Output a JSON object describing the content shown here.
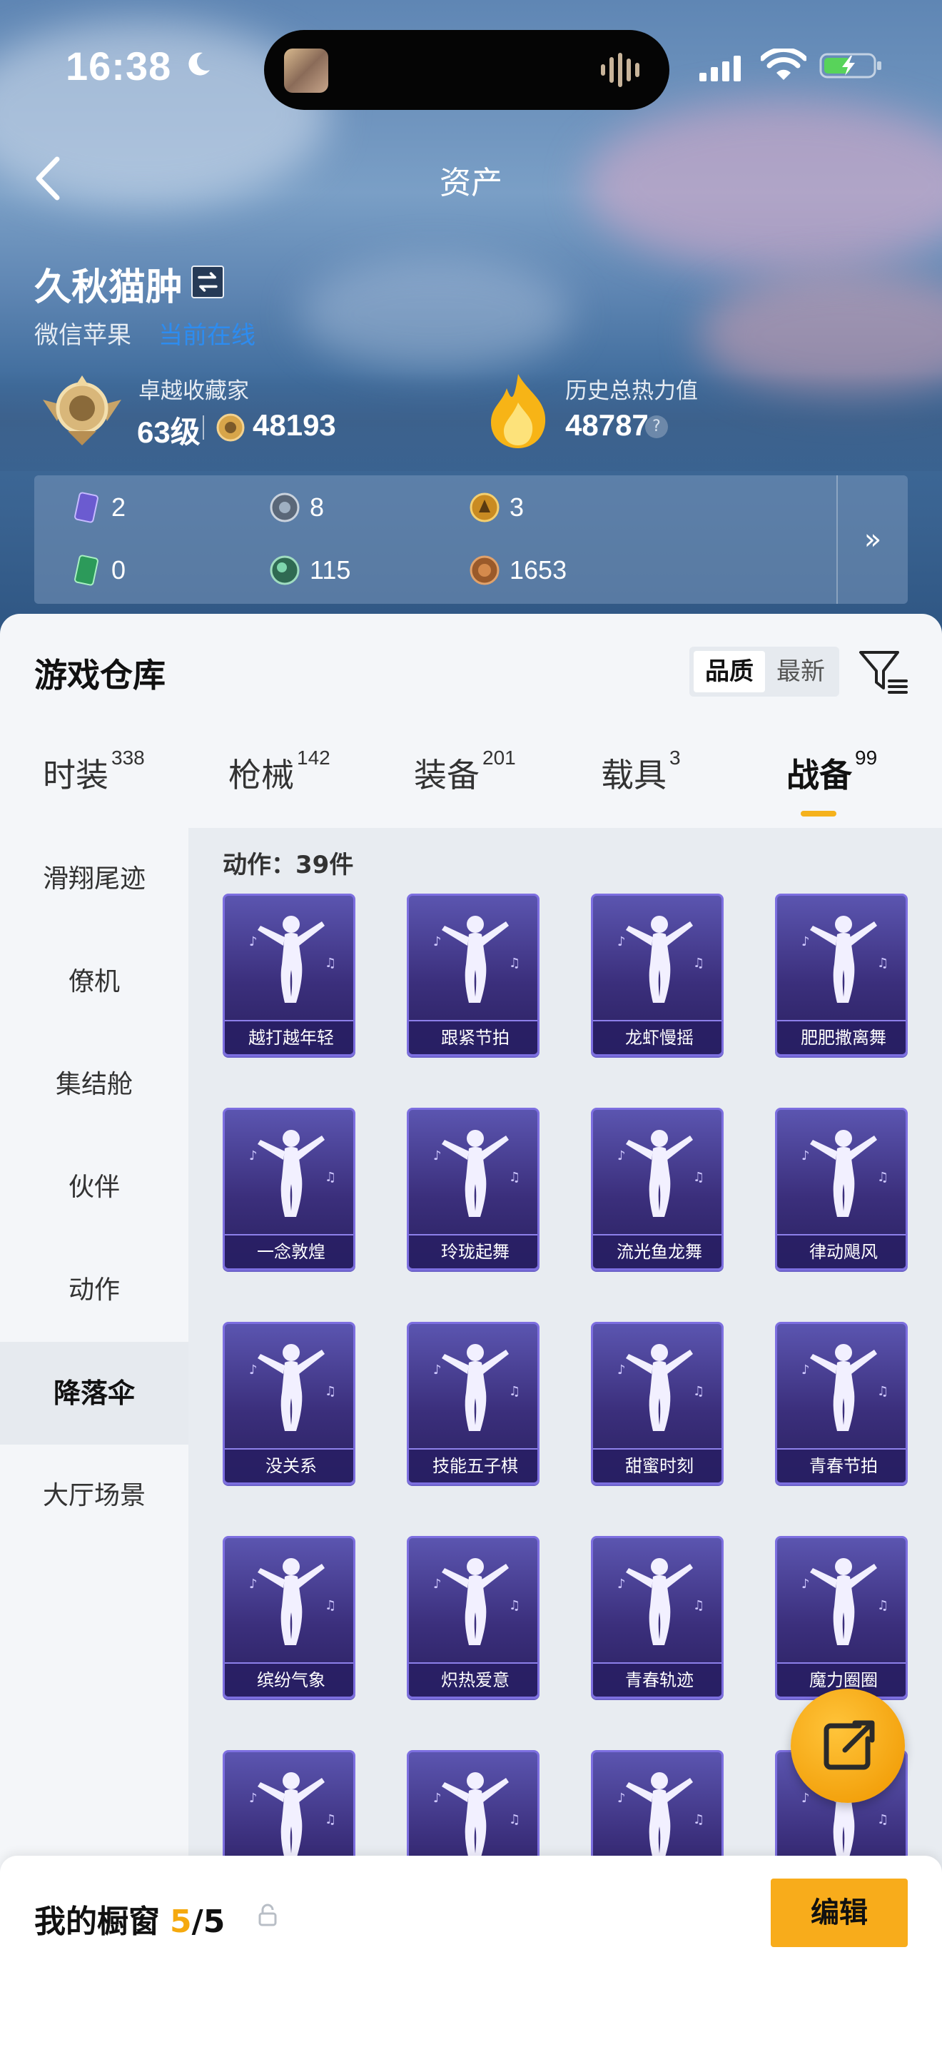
{
  "status_bar": {
    "time": "16:38"
  },
  "header": {
    "title": "资产"
  },
  "profile": {
    "name": "久秋猫肿",
    "platform": "微信苹果",
    "online_status": "当前在线",
    "collector_title": "卓越收藏家",
    "level": "63级",
    "coins": "48193",
    "heat_label": "历史总热力值",
    "heat_value": "48787"
  },
  "resources": [
    {
      "icon": "purple-card-icon",
      "value": "2"
    },
    {
      "icon": "silver-coin-icon",
      "value": "8"
    },
    {
      "icon": "gold-coin-icon",
      "value": "3"
    },
    {
      "icon": "green-card-icon",
      "value": "0"
    },
    {
      "icon": "green-orb-icon",
      "value": "115"
    },
    {
      "icon": "bronze-coin-icon",
      "value": "1653"
    }
  ],
  "warehouse": {
    "title": "游戏仓库",
    "sort_options": [
      "品质",
      "最新"
    ],
    "sort_selected": "品质"
  },
  "categories": [
    {
      "label": "时装",
      "count": "338"
    },
    {
      "label": "枪械",
      "count": "142"
    },
    {
      "label": "装备",
      "count": "201"
    },
    {
      "label": "载具",
      "count": "3"
    },
    {
      "label": "战备",
      "count": "99"
    }
  ],
  "active_category": "战备",
  "side_nav": [
    "滑翔尾迹",
    "僚机",
    "集结舱",
    "伙伴",
    "动作",
    "降落伞",
    "大厅场景"
  ],
  "active_side": "降落伞",
  "grid": {
    "count_label": "动作：39件",
    "items": [
      "越打越年轻",
      "跟紧节拍",
      "龙虾慢摇",
      "肥肥撒离舞",
      "一念敦煌",
      "玲珑起舞",
      "流光鱼龙舞",
      "律动飓风",
      "没关系",
      "技能五子棋",
      "甜蜜时刻",
      "青春节拍",
      "缤纷气象",
      "炽热爱意",
      "青春轨迹",
      "魔力圈圈"
    ]
  },
  "bottom": {
    "title": "我的橱窗",
    "used": "5",
    "total": "/5",
    "edit_label": "编辑"
  },
  "colors": {
    "accent": "#f5b21c",
    "card_top": "#5b55b0",
    "card_bottom": "#2a2160",
    "online": "#2d8cf0"
  }
}
